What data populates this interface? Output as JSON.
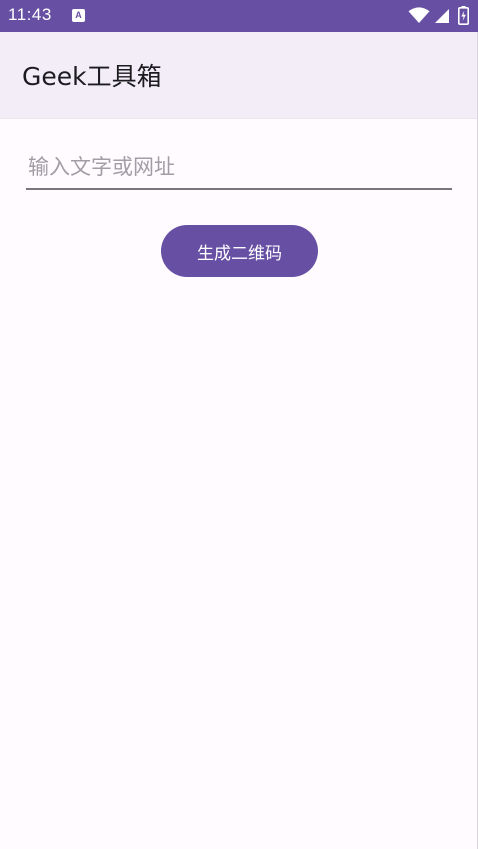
{
  "status_bar": {
    "time": "11:43",
    "notification_icon": "A",
    "icons": [
      "wifi-icon",
      "signal-icon",
      "battery-icon"
    ]
  },
  "app_bar": {
    "title": "Geek工具箱"
  },
  "main": {
    "text_input": {
      "placeholder": "输入文字或网址",
      "value": ""
    },
    "generate_button_label": "生成二维码"
  },
  "colors": {
    "primary": "#6750a4",
    "app_bar_bg": "#f3edf7",
    "background": "#fffbfe",
    "on_surface": "#1c1b1f",
    "placeholder": "#a19da6",
    "underline": "#79747e"
  }
}
